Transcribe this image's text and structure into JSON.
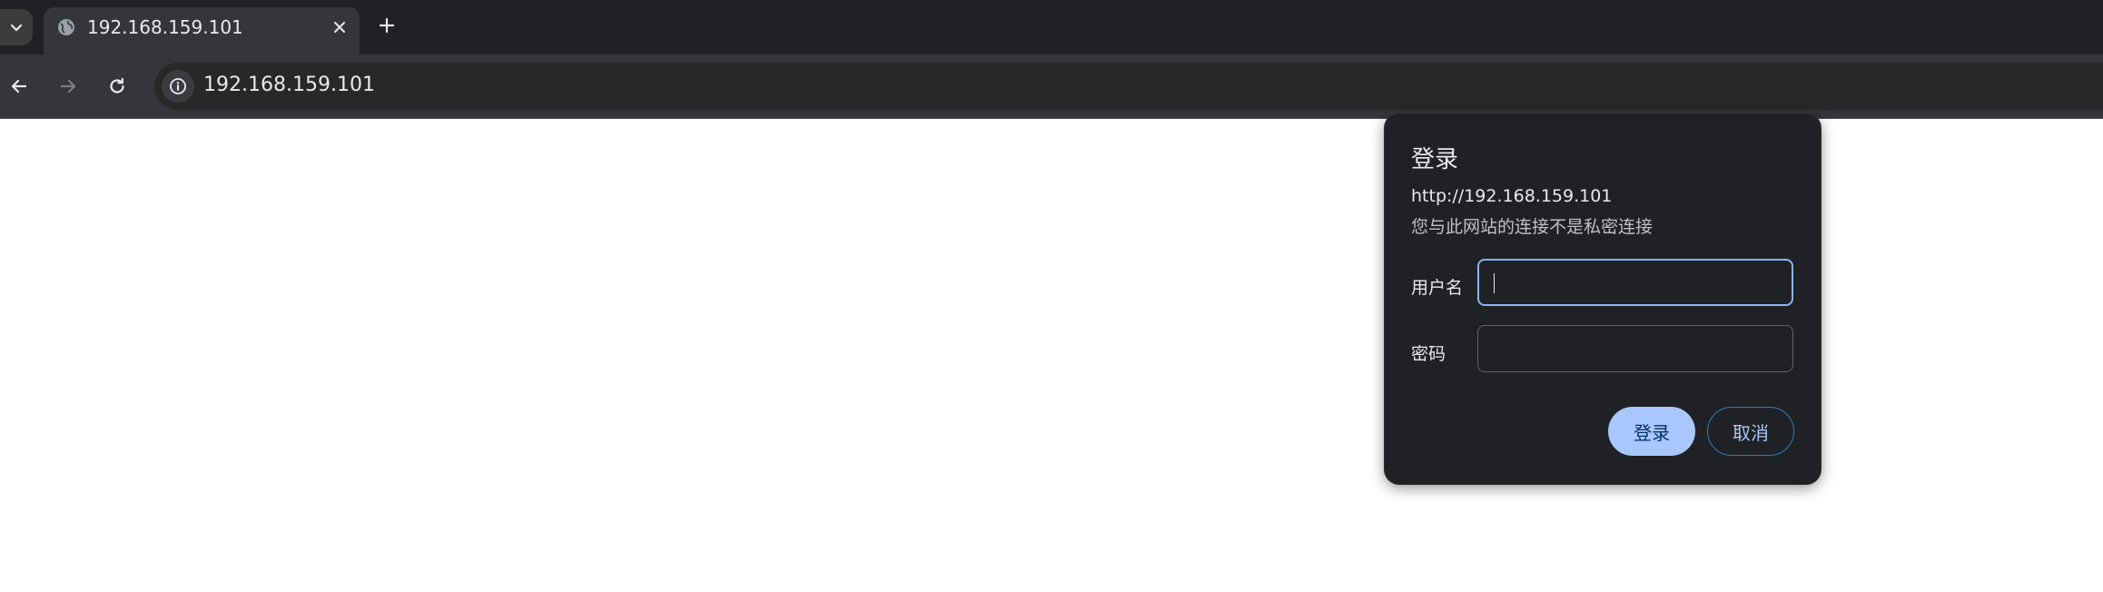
{
  "tab": {
    "title": "192.168.159.101"
  },
  "omnibox": {
    "url": "192.168.159.101"
  },
  "dialog": {
    "title": "登录",
    "origin": "http://192.168.159.101",
    "warning": "您与此网站的连接不是私密连接",
    "username_label": "用户名",
    "username_value": "",
    "password_label": "密码",
    "password_value": "",
    "login_button": "登录",
    "cancel_button": "取消"
  },
  "colors": {
    "accent": "#a8c7fa",
    "focus_ring": "#8ab4f8",
    "dialog_bg": "#202124",
    "toolbar_bg": "#35363a"
  },
  "icons": [
    "tab-search-icon",
    "globe-icon",
    "close-icon",
    "plus-icon",
    "back-arrow-icon",
    "forward-arrow-icon",
    "reload-icon",
    "info-icon"
  ]
}
